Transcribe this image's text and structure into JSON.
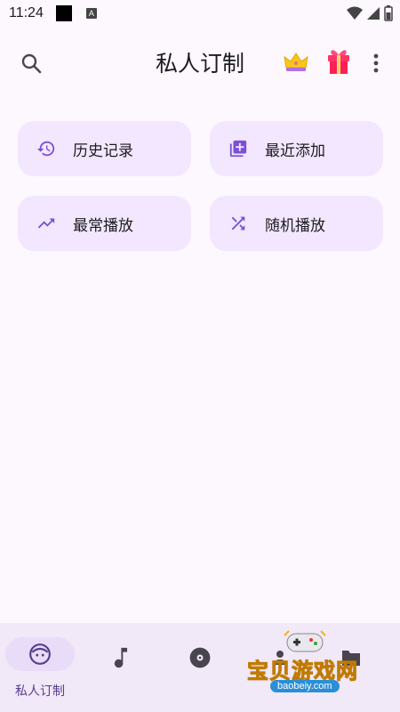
{
  "status_bar": {
    "time": "11:24",
    "a_label": "A"
  },
  "header": {
    "title": "私人订制"
  },
  "cards": [
    {
      "label": "历史记录",
      "icon": "history-icon"
    },
    {
      "label": "最近添加",
      "icon": "library-add-icon"
    },
    {
      "label": "最常播放",
      "icon": "trending-up-icon"
    },
    {
      "label": "随机播放",
      "icon": "shuffle-icon"
    }
  ],
  "bottom_nav": {
    "items": [
      {
        "label": "私人订制",
        "icon": "face-icon",
        "active": true
      },
      {
        "label": "",
        "icon": "music-note-icon"
      },
      {
        "label": "",
        "icon": "album-icon"
      }
    ]
  },
  "watermark": {
    "text": "宝贝游戏网",
    "url": "baobeiy.com"
  },
  "colors": {
    "accent": "#7b4fd6",
    "card_bg": "#f2e7fe",
    "background": "#fdf7fe"
  }
}
